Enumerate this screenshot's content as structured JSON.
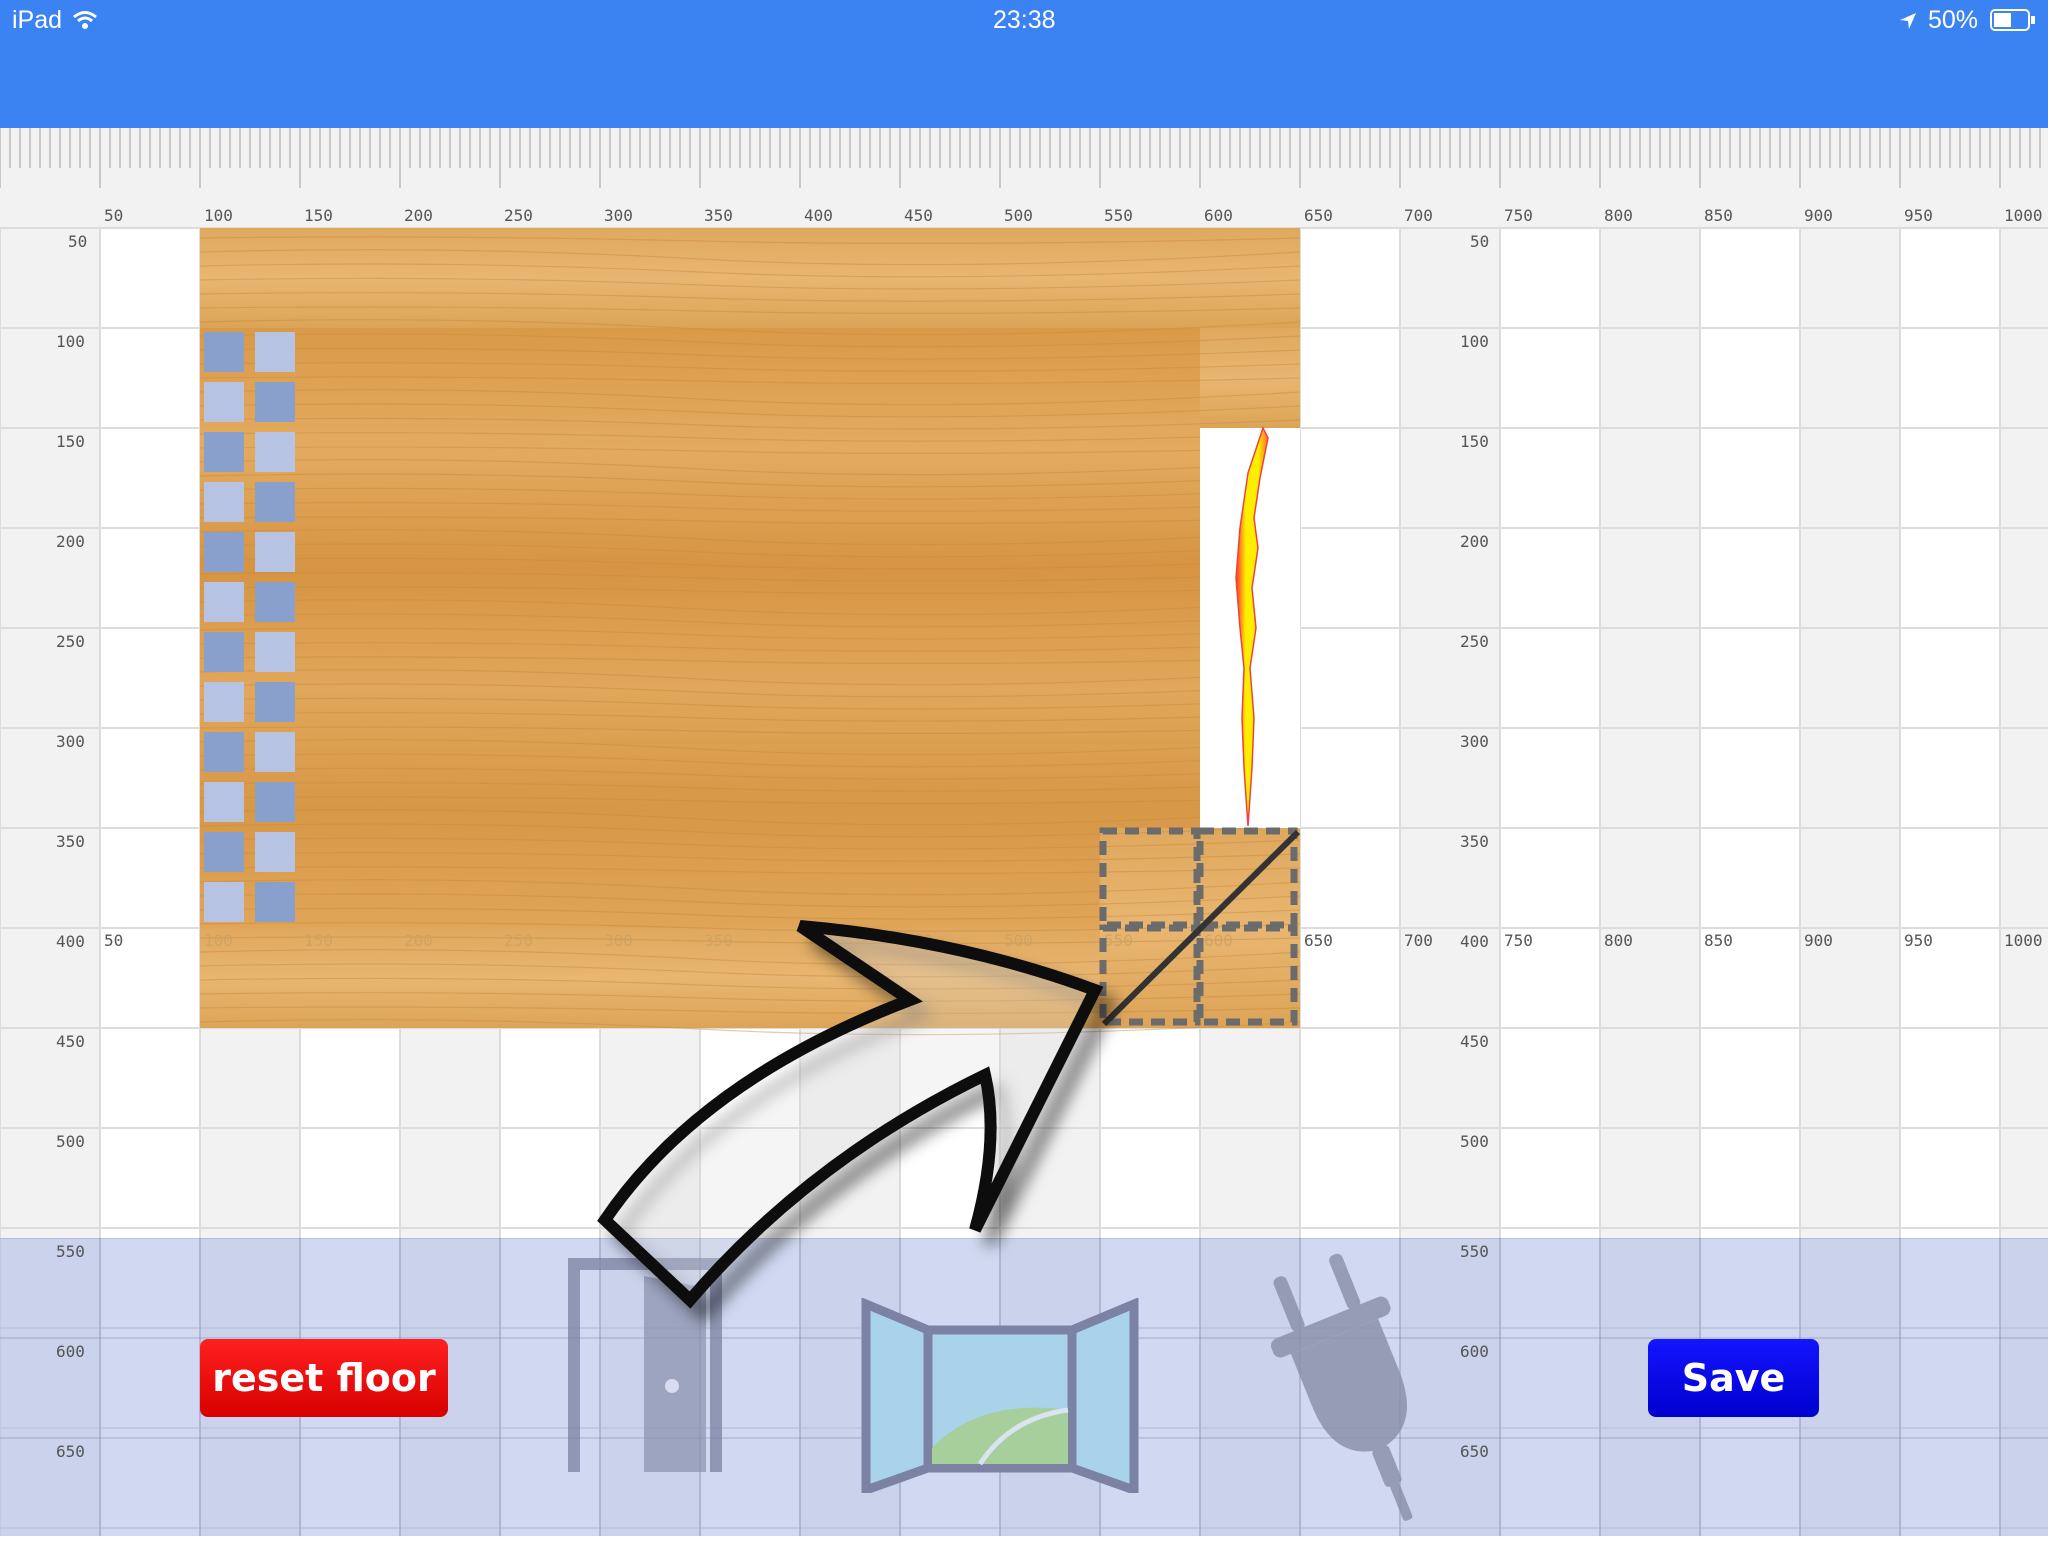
{
  "status_bar": {
    "device": "iPad",
    "time": "23:38",
    "battery": "50%"
  },
  "ruler": {
    "x_labels": [
      "50",
      "100",
      "150",
      "200",
      "250",
      "300",
      "350",
      "400",
      "450",
      "500",
      "550",
      "600",
      "650",
      "700",
      "750",
      "800",
      "850",
      "900",
      "950",
      "1000"
    ],
    "y_labels": [
      "50",
      "100",
      "150",
      "200",
      "250",
      "300",
      "350",
      "400",
      "450",
      "500",
      "550",
      "600",
      "650"
    ]
  },
  "floor": {
    "texture": "light-oak-wood",
    "color": "#d99a4a"
  },
  "tools": [
    "door-icon",
    "window-icon",
    "power-plug-icon"
  ],
  "buttons": {
    "reset_label": "reset floor",
    "save_label": "Save"
  },
  "colors": {
    "status_bar": "#3b82f2",
    "reset": "#e00000",
    "save": "#0000e6",
    "toolbar": "#b4c0e8"
  }
}
